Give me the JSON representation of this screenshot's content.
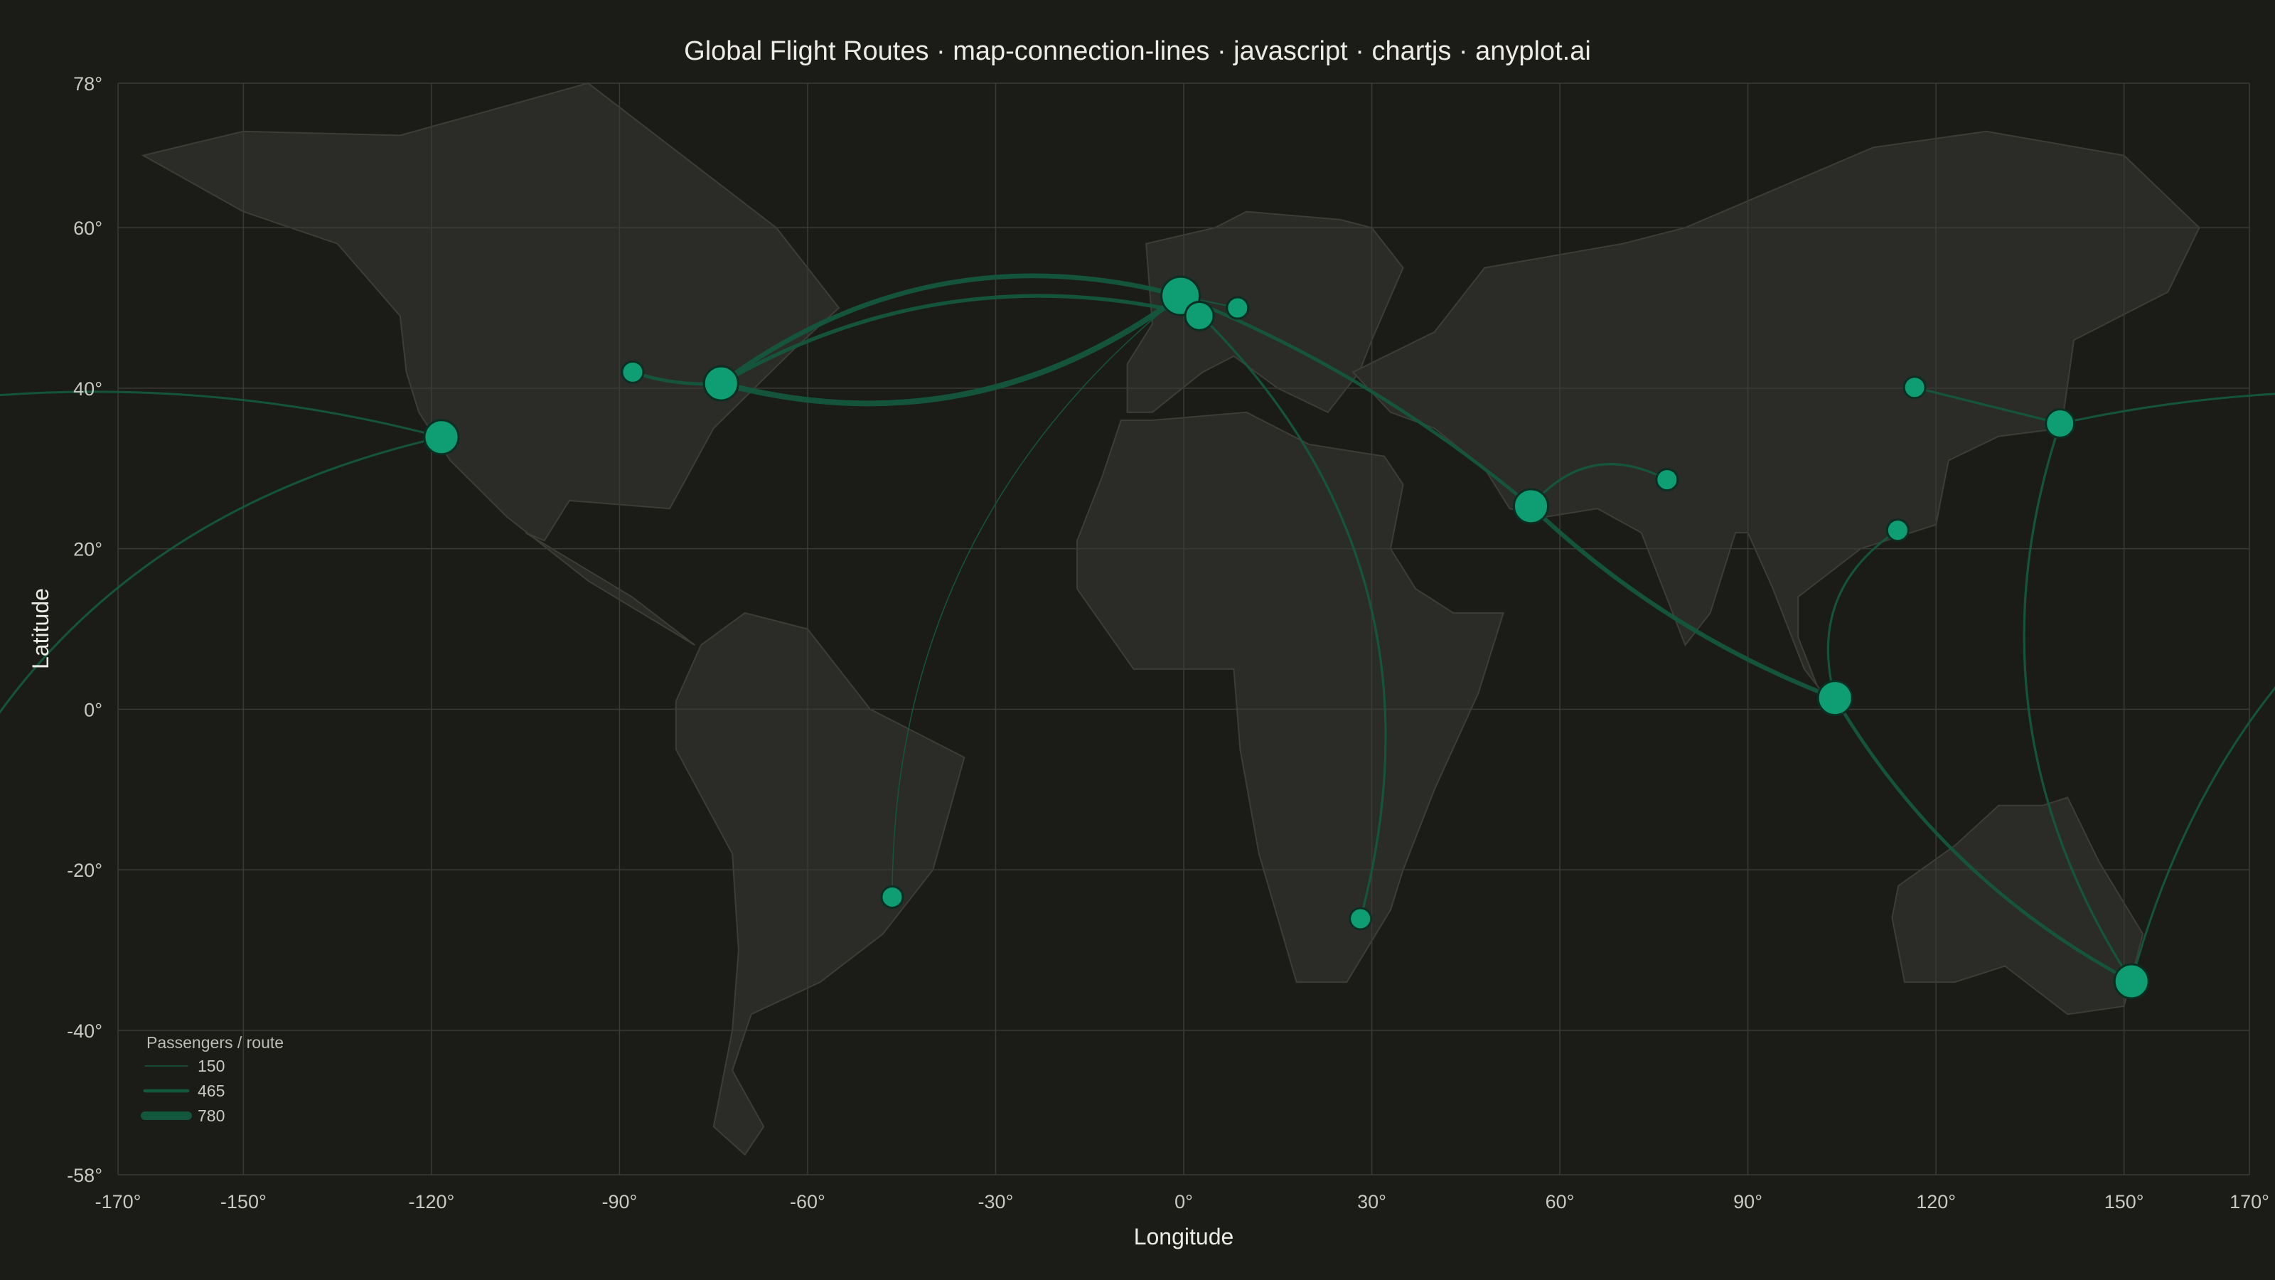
{
  "chart_data": {
    "type": "map-connection-lines",
    "title": "Global Flight Routes · map-connection-lines · javascript · chartjs · anyplot.ai",
    "xlabel": "Longitude",
    "ylabel": "Latitude",
    "xlim": [
      -170,
      170
    ],
    "ylim": [
      -58,
      78
    ],
    "xticks": [
      -170,
      -150,
      -120,
      -90,
      -60,
      -30,
      0,
      30,
      60,
      90,
      120,
      150,
      170
    ],
    "yticks": [
      78,
      60,
      40,
      20,
      0,
      -20,
      -40,
      -58
    ],
    "tick_suffix": "°",
    "grid": true,
    "colors": {
      "background": "#1b1b17",
      "land": "#2b2b27",
      "land_stroke": "#3d3d38",
      "grid": "#3a3a36",
      "route": "#14573f",
      "airport": "#0f9e74",
      "airport_stroke": "#0b2e22",
      "text": "#ecebe6",
      "tick_text": "#c9c8c2"
    },
    "legend": {
      "title": "Passengers / route",
      "position": "bottom-left",
      "entries": [
        {
          "label": "150",
          "value": 150
        },
        {
          "label": "465",
          "value": 465
        },
        {
          "label": "780",
          "value": 780
        }
      ]
    },
    "airports": [
      {
        "lon": -118.4,
        "lat": 33.9,
        "size": "large"
      },
      {
        "lon": -87.9,
        "lat": 42.0,
        "size": "small"
      },
      {
        "lon": -73.8,
        "lat": 40.6,
        "size": "large"
      },
      {
        "lon": -46.5,
        "lat": -23.4,
        "size": "small"
      },
      {
        "lon": -0.5,
        "lat": 51.5,
        "size": "xlarge"
      },
      {
        "lon": 2.5,
        "lat": 49.0,
        "size": "medium"
      },
      {
        "lon": 8.6,
        "lat": 50.0,
        "size": "small"
      },
      {
        "lon": 28.2,
        "lat": -26.1,
        "size": "small"
      },
      {
        "lon": 55.4,
        "lat": 25.3,
        "size": "large"
      },
      {
        "lon": 77.1,
        "lat": 28.6,
        "size": "small"
      },
      {
        "lon": 103.9,
        "lat": 1.4,
        "size": "large"
      },
      {
        "lon": 113.9,
        "lat": 22.3,
        "size": "small"
      },
      {
        "lon": 116.6,
        "lat": 40.1,
        "size": "small"
      },
      {
        "lon": 139.8,
        "lat": 35.6,
        "size": "medium"
      },
      {
        "lon": 151.2,
        "lat": -33.9,
        "size": "large"
      }
    ],
    "routes": [
      {
        "from": 2,
        "to": 4,
        "bend": 0.12,
        "passengers": 780
      },
      {
        "from": 2,
        "to": 4,
        "bend": -0.12,
        "passengers": 650
      },
      {
        "from": 2,
        "to": 5,
        "bend": -0.1,
        "passengers": 520
      },
      {
        "from": 1,
        "to": 2,
        "bend": 0.05,
        "passengers": 465
      },
      {
        "from": 0,
        "to": 2,
        "bend": 0.0,
        "passengers": 0
      },
      {
        "from": 0,
        "to": 13,
        "bend": 0.06,
        "passengers": 300,
        "wrap": "west"
      },
      {
        "from": 0,
        "to": 14,
        "bend": 0.15,
        "passengers": 300,
        "wrap": "west"
      },
      {
        "from": 4,
        "to": 8,
        "bend": -0.04,
        "passengers": 465
      },
      {
        "from": 4,
        "to": 7,
        "bend": -0.15,
        "passengers": 320
      },
      {
        "from": 4,
        "to": 3,
        "bend": 0.12,
        "passengers": 150
      },
      {
        "from": 4,
        "to": 6,
        "bend": 0.0,
        "passengers": 200
      },
      {
        "from": 8,
        "to": 9,
        "bend": -0.2,
        "passengers": 320
      },
      {
        "from": 8,
        "to": 10,
        "bend": 0.05,
        "passengers": 600
      },
      {
        "from": 10,
        "to": 14,
        "bend": 0.07,
        "passengers": 465
      },
      {
        "from": 10,
        "to": 11,
        "bend": -0.18,
        "passengers": 300
      },
      {
        "from": 12,
        "to": 13,
        "bend": 0.0,
        "passengers": 320
      },
      {
        "from": 13,
        "to": 14,
        "bend": 0.12,
        "passengers": 320
      }
    ],
    "land": [
      [
        [
          -166,
          69
        ],
        [
          -150,
          72
        ],
        [
          -125,
          71.5
        ],
        [
          -95,
          78
        ],
        [
          -80,
          69
        ],
        [
          -65,
          60
        ],
        [
          -55,
          50
        ],
        [
          -62,
          45
        ],
        [
          -75,
          35
        ],
        [
          -82,
          25
        ],
        [
          -98,
          26
        ],
        [
          -102,
          21
        ],
        [
          -105,
          22
        ],
        [
          -88,
          14
        ],
        [
          -78,
          8
        ],
        [
          -95,
          16
        ],
        [
          -108,
          24
        ],
        [
          -117,
          31
        ],
        [
          -122,
          37
        ],
        [
          -124,
          42
        ],
        [
          -125,
          49
        ],
        [
          -135,
          58
        ],
        [
          -150,
          62
        ]
      ],
      [
        [
          -77,
          8
        ],
        [
          -70,
          12
        ],
        [
          -60,
          10
        ],
        [
          -50,
          0
        ],
        [
          -35,
          -6
        ],
        [
          -40,
          -20
        ],
        [
          -48,
          -28
        ],
        [
          -58,
          -34
        ],
        [
          -69,
          -38
        ],
        [
          -72,
          -45
        ],
        [
          -67,
          -52
        ],
        [
          -70,
          -55.5
        ],
        [
          -75,
          -52
        ],
        [
          -72,
          -40
        ],
        [
          -71,
          -30
        ],
        [
          -72,
          -18
        ],
        [
          -81,
          -5
        ],
        [
          -81,
          1
        ]
      ],
      [
        [
          -10,
          36
        ],
        [
          -5,
          36
        ],
        [
          10,
          37
        ],
        [
          20,
          33
        ],
        [
          32,
          31.5
        ],
        [
          35,
          28
        ],
        [
          33,
          20
        ],
        [
          37,
          15
        ],
        [
          43,
          12
        ],
        [
          51,
          12
        ],
        [
          47,
          2
        ],
        [
          40,
          -10
        ],
        [
          35,
          -20
        ],
        [
          33,
          -25
        ],
        [
          26,
          -34
        ],
        [
          18,
          -34
        ],
        [
          12,
          -18
        ],
        [
          9,
          -5
        ],
        [
          8,
          5
        ],
        [
          -8,
          5
        ],
        [
          -17,
          15
        ],
        [
          -17,
          21
        ],
        [
          -13,
          29
        ]
      ],
      [
        [
          -9,
          37
        ],
        [
          -9,
          43
        ],
        [
          -5,
          48
        ],
        [
          -6,
          58
        ],
        [
          5,
          60
        ],
        [
          10,
          62
        ],
        [
          25,
          61
        ],
        [
          30,
          60
        ],
        [
          35,
          55
        ],
        [
          30,
          46
        ],
        [
          28,
          42
        ],
        [
          23,
          37
        ],
        [
          15,
          40
        ],
        [
          8,
          44
        ],
        [
          3,
          42
        ],
        [
          -5,
          37
        ]
      ],
      [
        [
          27,
          42
        ],
        [
          40,
          47
        ],
        [
          48,
          55
        ],
        [
          70,
          58
        ],
        [
          80,
          60
        ],
        [
          110,
          70
        ],
        [
          128,
          72
        ],
        [
          150,
          69
        ],
        [
          162,
          60
        ],
        [
          157,
          52
        ],
        [
          142,
          46
        ],
        [
          140,
          35
        ],
        [
          130,
          34
        ],
        [
          122,
          31
        ],
        [
          120,
          23
        ],
        [
          108,
          20
        ],
        [
          98,
          14
        ],
        [
          98,
          9
        ],
        [
          101,
          3
        ],
        [
          103,
          1
        ],
        [
          99,
          5
        ],
        [
          94,
          15
        ],
        [
          90,
          22
        ],
        [
          88,
          22
        ],
        [
          84,
          12
        ],
        [
          80,
          8
        ],
        [
          77,
          14
        ],
        [
          73,
          22
        ],
        [
          66,
          25
        ],
        [
          58,
          24
        ],
        [
          52,
          25
        ],
        [
          48,
          30
        ],
        [
          40,
          35
        ],
        [
          33,
          37
        ]
      ],
      [
        [
          114,
          -22
        ],
        [
          123,
          -17
        ],
        [
          130,
          -12
        ],
        [
          137,
          -12
        ],
        [
          141,
          -11
        ],
        [
          146,
          -19
        ],
        [
          153,
          -28
        ],
        [
          150,
          -37
        ],
        [
          141,
          -38
        ],
        [
          131,
          -32
        ],
        [
          123,
          -34
        ],
        [
          115,
          -34
        ],
        [
          113,
          -26
        ]
      ]
    ]
  }
}
